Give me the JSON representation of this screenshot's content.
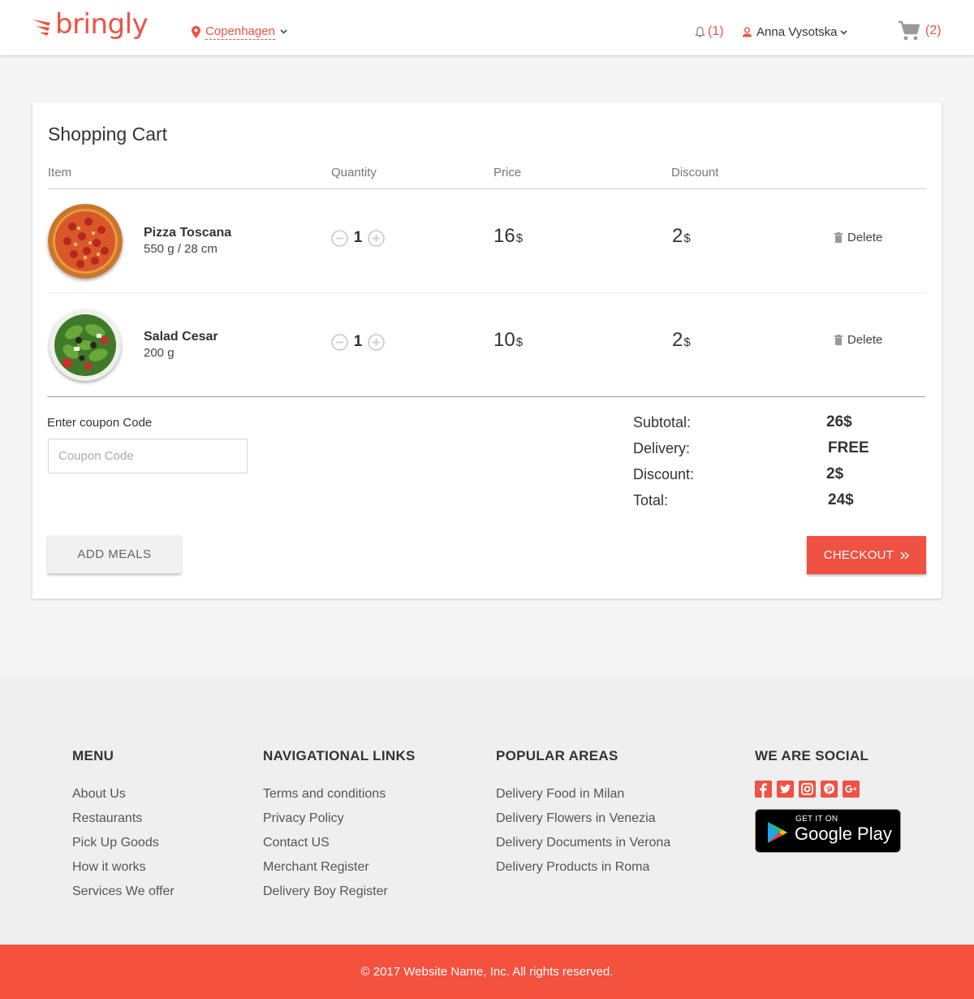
{
  "header": {
    "logo_text": "bringly",
    "location": "Copenhagen",
    "notifications_count": "(1)",
    "user_name": "Anna Vysotska",
    "cart_count": "(2)"
  },
  "cart": {
    "title": "Shopping Cart",
    "columns": {
      "item": "Item",
      "quantity": "Quantity",
      "price": "Price",
      "discount": "Discount"
    },
    "items": [
      {
        "name": "Pizza Toscana",
        "detail": "550 g / 28 cm",
        "quantity": "1",
        "price": "16",
        "discount": "2",
        "currency": "$",
        "delete_label": "Delete"
      },
      {
        "name": "Salad Cesar",
        "detail": "200 g",
        "quantity": "1",
        "price": "10",
        "discount": "2",
        "currency": "$",
        "delete_label": "Delete"
      }
    ],
    "coupon": {
      "label": "Enter coupon Code",
      "placeholder": "Coupon Code"
    },
    "summary": {
      "subtotal_label": "Subtotal:",
      "subtotal_value": "26$",
      "delivery_label": "Delivery:",
      "delivery_value": "FREE",
      "discount_label": "Discount:",
      "discount_value": "2$",
      "total_label": "Total:",
      "total_value": "24$"
    },
    "add_meals_label": "ADD MEALS",
    "checkout_label": "CHECKOUT"
  },
  "footer": {
    "menu": {
      "title": "MENU",
      "links": [
        "About Us",
        "Restaurants",
        "Pick Up Goods",
        "How it works",
        "Services We offer"
      ]
    },
    "nav": {
      "title": "NAVIGATIONAL LINKS",
      "links": [
        "Terms and conditions",
        "Privacy Policy",
        "Contact US",
        "Merchant Register",
        "Delivery Boy Register"
      ]
    },
    "areas": {
      "title": "POPULAR AREAS",
      "links": [
        "Delivery Food in Milan",
        "Delivery Flowers in Venezia",
        "Delivery Documents in Verona",
        "Delivery Products in Roma"
      ]
    },
    "social": {
      "title": "WE ARE SOCIAL",
      "icons": [
        "facebook-icon",
        "twitter-icon",
        "instagram-icon",
        "pinterest-icon",
        "google-plus-icon"
      ],
      "store_small": "GET IT ON",
      "store_big": "Google Play"
    },
    "copyright": "© 2017 Website Name, Inc. All rights reserved."
  },
  "colors": {
    "accent": "#ef5143",
    "footer_bar": "#f4513f",
    "background": "#f5f5f5"
  }
}
